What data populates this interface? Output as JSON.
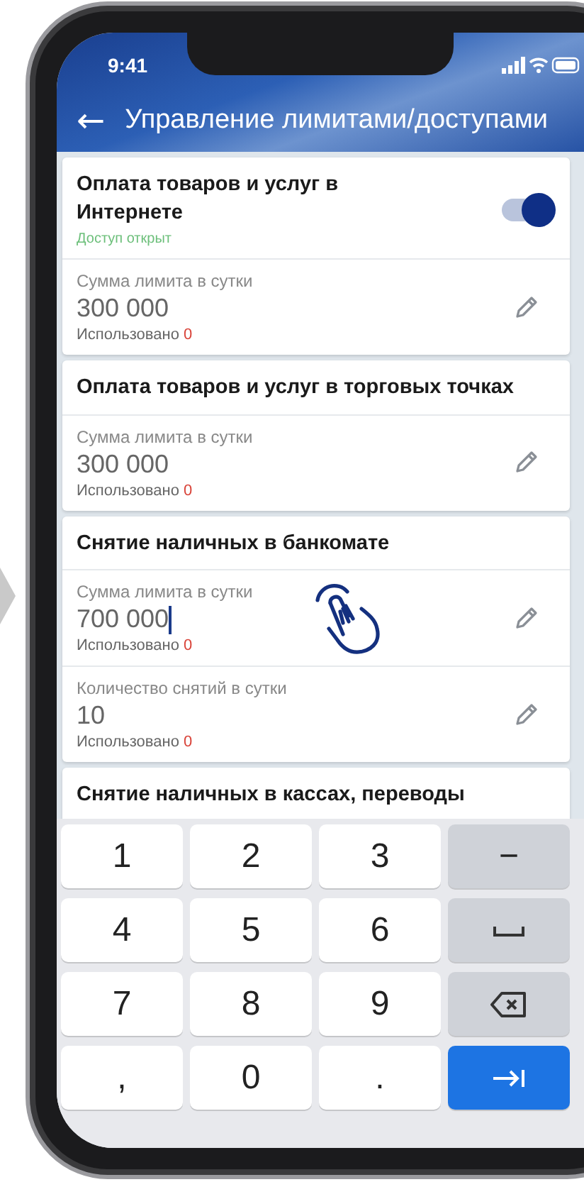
{
  "status_bar": {
    "time": "9:41"
  },
  "header": {
    "back": "←",
    "title": "Управление лимитами/доступами"
  },
  "sections": [
    {
      "title": "Оплата товаров и услуг в Интернете",
      "toggle": {
        "on": true,
        "status": "Доступ открыт"
      },
      "limits": [
        {
          "label": "Сумма лимита в сутки",
          "value": "300 000",
          "used_label": "Использовано",
          "used_count": "0",
          "editing": false
        }
      ]
    },
    {
      "title": "Оплата товаров и услуг в торговых точках",
      "limits": [
        {
          "label": "Сумма лимита в сутки",
          "value": "300 000",
          "used_label": "Использовано",
          "used_count": "0",
          "editing": false
        }
      ]
    },
    {
      "title": "Снятие наличных в банкомате",
      "limits": [
        {
          "label": "Сумма лимита в сутки",
          "value": "700 000",
          "used_label": "Использовано",
          "used_count": "0",
          "editing": true
        },
        {
          "label": "Количество снятий в сутки",
          "value": "10",
          "used_label": "Использовано",
          "used_count": "0",
          "editing": false
        }
      ]
    },
    {
      "title": "Снятие наличных в кассах, переводы"
    }
  ],
  "keyboard": [
    {
      "kind": "digit",
      "label": "1"
    },
    {
      "kind": "digit",
      "label": "2"
    },
    {
      "kind": "digit",
      "label": "3"
    },
    {
      "kind": "function",
      "label": "−"
    },
    {
      "kind": "digit",
      "label": "4"
    },
    {
      "kind": "digit",
      "label": "5"
    },
    {
      "kind": "digit",
      "label": "6"
    },
    {
      "kind": "space"
    },
    {
      "kind": "digit",
      "label": "7"
    },
    {
      "kind": "digit",
      "label": "8"
    },
    {
      "kind": "digit",
      "label": "9"
    },
    {
      "kind": "backspace"
    },
    {
      "kind": "digit",
      "label": ","
    },
    {
      "kind": "digit",
      "label": "0"
    },
    {
      "kind": "digit",
      "label": "."
    },
    {
      "kind": "next"
    }
  ]
}
